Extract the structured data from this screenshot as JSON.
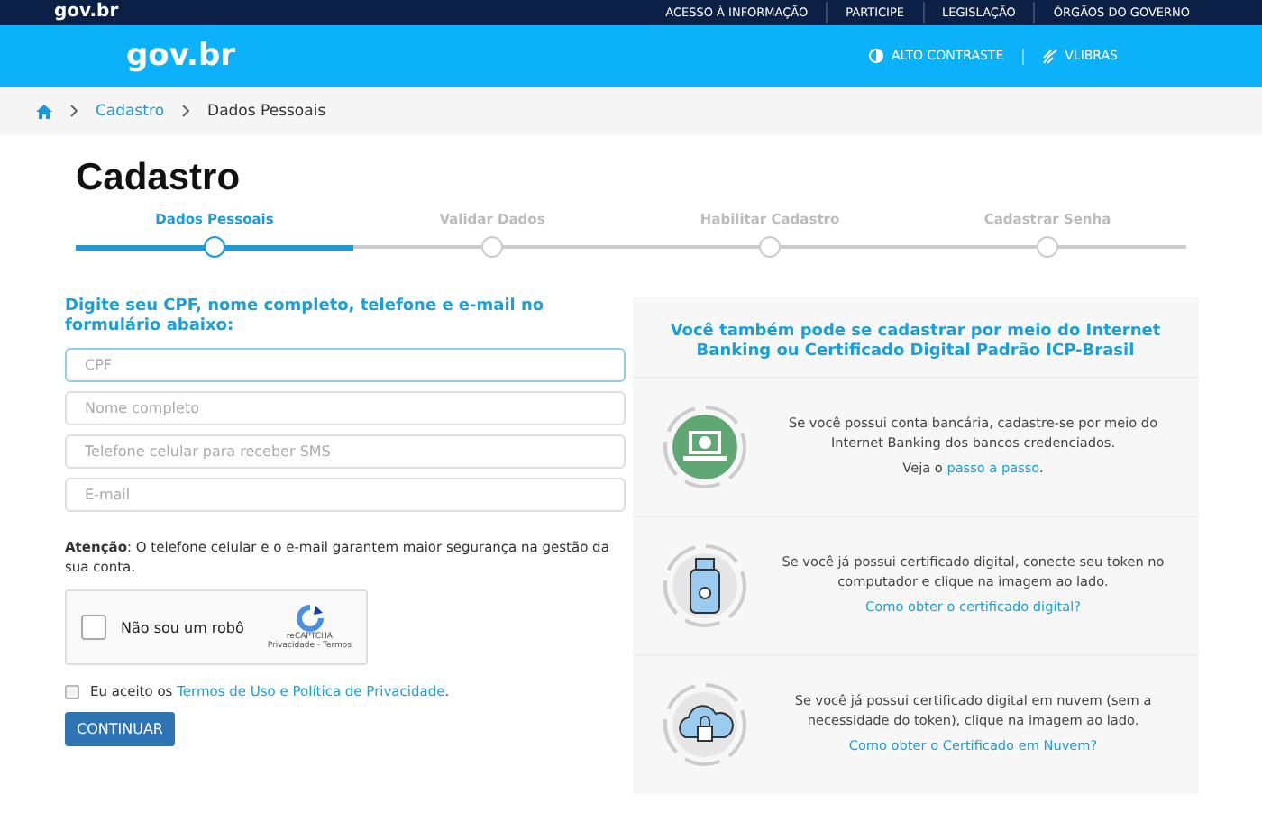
{
  "top_bar": {
    "logo": "gov.br",
    "links": [
      "ACESSO À INFORMAÇÃO",
      "PARTICIPE",
      "LEGISLAÇÃO",
      "ÓRGÃOS DO GOVERNO"
    ]
  },
  "header": {
    "logo": "gov.br",
    "actions": [
      {
        "kind": "contrast",
        "label": "ALTO CONTRASTE"
      },
      {
        "kind": "vlibras",
        "label": "VLIBRAS"
      }
    ]
  },
  "breadcrumb": [
    "Cadastro",
    "Dados Pessoais"
  ],
  "title": "Cadastro",
  "steps": [
    {
      "label": "Dados Pessoais",
      "selected": true
    },
    {
      "label": "Validar Dados",
      "selected": false
    },
    {
      "label": "Habilitar Cadastro",
      "selected": false
    },
    {
      "label": "Cadastrar Senha",
      "selected": false
    }
  ],
  "form": {
    "heading": "Digite seu CPF, nome completo, telefone e e-mail no formulário abaixo:",
    "fields": [
      {
        "placeholder": "CPF"
      },
      {
        "placeholder": "Nome completo"
      },
      {
        "placeholder": "Telefone celular para receber SMS"
      },
      {
        "placeholder": "E-mail"
      }
    ],
    "notice": "**Atenção**: O telefone celular e o e-mail garantem maior segurança na gestão da sua conta.",
    "captcha": {
      "label": "Não sou um robô",
      "brand": "reCAPTCHA",
      "terms": "Privacidade - Termos",
      "checked": false
    },
    "terms": {
      "checked": false,
      "before": "Eu aceito os ",
      "link": "Termos de Uso e Política de Privacidade",
      "after": "."
    },
    "button": "CONTINUAR"
  },
  "alternatives": {
    "heading": "Você também pode se cadastrar por meio do Internet Banking ou Certificado Digital Padrão ICP-Brasil",
    "options": [
      {
        "kind": "bank",
        "text": "Se você possui conta bancária, cadastre-se por meio do Internet Banking dos bancos credenciados.",
        "link_before": "Veja o ",
        "link": "passo a passo",
        "link_after": "."
      },
      {
        "kind": "token",
        "text": "Se você já possui certificado digital, conecte seu token no computador e clique na imagem ao lado.",
        "link": "Como obter o certificado digital?"
      },
      {
        "kind": "cloud",
        "text": "Se você já possui certificado digital em nuvem (sem a necessidade do token), clique na imagem ao lado.",
        "link": "Como obter o Certificado em Nuvem?"
      }
    ]
  }
}
